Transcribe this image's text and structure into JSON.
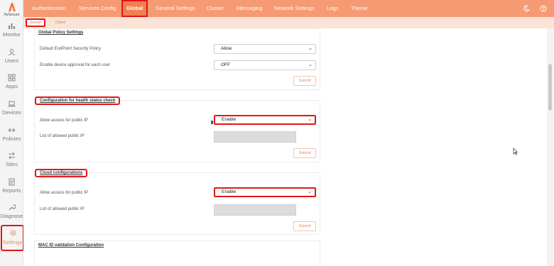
{
  "logo": {
    "name": "HySecure"
  },
  "sidebar": {
    "items": [
      {
        "label": "Monitor",
        "icon": "bar-chart-icon"
      },
      {
        "label": "Users",
        "icon": "user-icon"
      },
      {
        "label": "Apps",
        "icon": "apps-grid-icon"
      },
      {
        "label": "Devices",
        "icon": "laptop-icon"
      },
      {
        "label": "Policies",
        "icon": "arrows-icon"
      },
      {
        "label": "Sites",
        "icon": "shuffle-icon"
      },
      {
        "label": "Reports",
        "icon": "document-icon"
      },
      {
        "label": "Diagnose",
        "icon": "wrench-icon"
      },
      {
        "label": "Settings",
        "icon": "gear-icon",
        "active": true
      }
    ]
  },
  "topnav": {
    "tabs": [
      "Authentication",
      "Services Config",
      "Global",
      "General Settings",
      "Cluster",
      "Messaging",
      "Network Settings",
      "Logs",
      "Theme"
    ],
    "active": "Global"
  },
  "subnav": {
    "tabs": [
      "Server",
      "Client"
    ],
    "active": "Server"
  },
  "global_policy": {
    "title": "Global Policy Settings",
    "rows": [
      {
        "label": "Default EndPoint Security Policy",
        "value": "Allow"
      },
      {
        "label": "Enable device approval for each user",
        "value": "OFF"
      }
    ],
    "submit": "Submit"
  },
  "health_check": {
    "title": "Configuration for health status check",
    "access_label": "Allow access for public IP",
    "access_value": "Enable",
    "ip_label": "List of allowed public IP",
    "submit": "Submit"
  },
  "cloud": {
    "title": "Cloud configurations",
    "access_label": "Allow access for public IP",
    "access_value": "Enable",
    "ip_label": "List of allowed public IP",
    "submit": "Submit"
  },
  "mac": {
    "title": "MAC ID validation Configuration"
  },
  "colors": {
    "brand": "#f59a72",
    "highlight": "#e01818",
    "accent": "#f08a5d"
  }
}
